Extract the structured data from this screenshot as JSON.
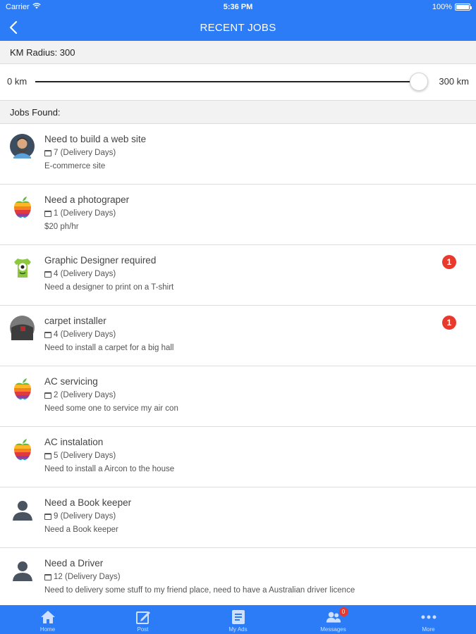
{
  "status_bar": {
    "carrier": "Carrier",
    "time": "5:36 PM",
    "battery": "100%"
  },
  "nav": {
    "title": "RECENT JOBS"
  },
  "radius": {
    "label": "KM Radius: 300",
    "min_label": "0 km",
    "max_label": "300 km",
    "value": 300,
    "max": 300
  },
  "jobs_header": "Jobs Found:",
  "jobs": [
    {
      "title": "Need to build a web site",
      "days": "7 (Delivery Days)",
      "desc": "E-commerce site",
      "avatar": "person-photo-icon",
      "badge": null
    },
    {
      "title": "Need a photograper",
      "days": "1 (Delivery Days)",
      "desc": "$20 ph/hr",
      "avatar": "apple-logo-icon",
      "badge": null
    },
    {
      "title": "Graphic Designer required",
      "days": "4 (Delivery Days)",
      "desc": "Need a designer to print on a T-shirt",
      "avatar": "monster-tshirt-icon",
      "badge": "1"
    },
    {
      "title": "carpet installer",
      "days": "4 (Delivery Days)",
      "desc": "Need to install a carpet for a big hall",
      "avatar": "carpet-photo-icon",
      "badge": "1"
    },
    {
      "title": "AC servicing",
      "days": "2 (Delivery Days)",
      "desc": "Need some one to service my air con",
      "avatar": "apple-logo-icon",
      "badge": null
    },
    {
      "title": "AC instalation",
      "days": "5 (Delivery Days)",
      "desc": "Need to install a Aircon to the house",
      "avatar": "apple-logo-icon",
      "badge": null
    },
    {
      "title": "Need a Book keeper",
      "days": "9 (Delivery Days)",
      "desc": "Need a Book keeper",
      "avatar": "user-silhouette-icon",
      "badge": null
    },
    {
      "title": "Need a Driver",
      "days": "12 (Delivery Days)",
      "desc": "Need to delivery some stuff to my friend place, need to have a Australian driver licence",
      "avatar": "user-silhouette-icon",
      "badge": null
    }
  ],
  "tabs": [
    {
      "label": "Home",
      "icon": "home-icon"
    },
    {
      "label": "Post",
      "icon": "post-icon"
    },
    {
      "label": "My Ads",
      "icon": "my-ads-icon"
    },
    {
      "label": "Messages",
      "icon": "messages-icon",
      "badge": "0"
    },
    {
      "label": "More",
      "icon": "more-icon"
    }
  ],
  "colors": {
    "primary": "#2b7cf6",
    "badge": "#e8392c"
  }
}
